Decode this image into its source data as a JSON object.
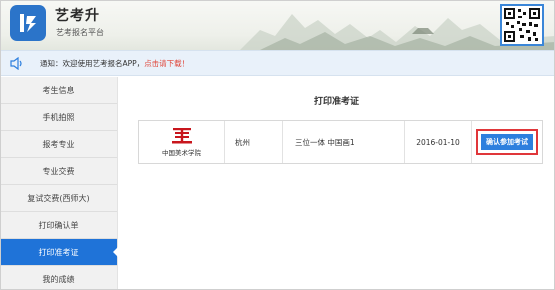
{
  "header": {
    "brand_title": "艺考升",
    "brand_subtitle": "艺考报名平台",
    "logo_icon": "brand-logo-icon",
    "qr_icon": "qr-code-icon"
  },
  "notice": {
    "icon": "speaker-icon",
    "text": "通知：欢迎使用艺考报名APP，",
    "link_text": "点击请下载！"
  },
  "sidebar": {
    "items": [
      {
        "label": "考生信息"
      },
      {
        "label": "手机拍照"
      },
      {
        "label": "报考专业"
      },
      {
        "label": "专业交费"
      },
      {
        "label": "复试交费(西师大)"
      },
      {
        "label": "打印确认单"
      },
      {
        "label": "打印准考证"
      },
      {
        "label": "我的成绩"
      }
    ],
    "active_index": 6
  },
  "main": {
    "title": "打印准考证",
    "rows": [
      {
        "school": "中国美术学院",
        "city": "杭州",
        "exam": "三位一体 中国画1",
        "date": "2016-01-10",
        "action": "确认参加考试"
      }
    ]
  },
  "colors": {
    "accent": "#1f73d8",
    "highlight_border": "#e0363a",
    "school_red": "#c8161d"
  }
}
